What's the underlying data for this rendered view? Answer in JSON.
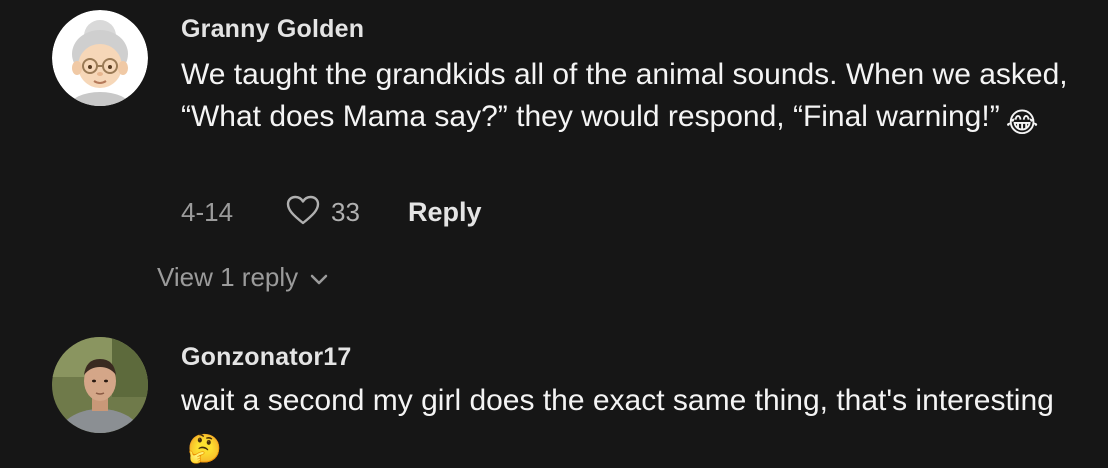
{
  "comments": [
    {
      "username": "Granny Golden",
      "avatar": "grandma-emoji-avatar",
      "text": "We taught the grandkids all of the animal sounds. When we asked, “What does Mama say?” they would respond, “Final warning!”",
      "emoji": "😂",
      "date": "4-14",
      "like_count": "33",
      "reply_label": "Reply",
      "view_replies_label": "View 1 reply"
    },
    {
      "username": "Gonzonator17",
      "avatar": "user-photo-avatar",
      "text": "wait a second my girl does the exact same thing, that's interesting",
      "emoji": "🤔"
    }
  ],
  "colors": {
    "background": "#161616",
    "text": "#f4f4f4",
    "muted": "#9b9b9b"
  },
  "icons": [
    "heart-icon",
    "chevron-down-icon"
  ]
}
